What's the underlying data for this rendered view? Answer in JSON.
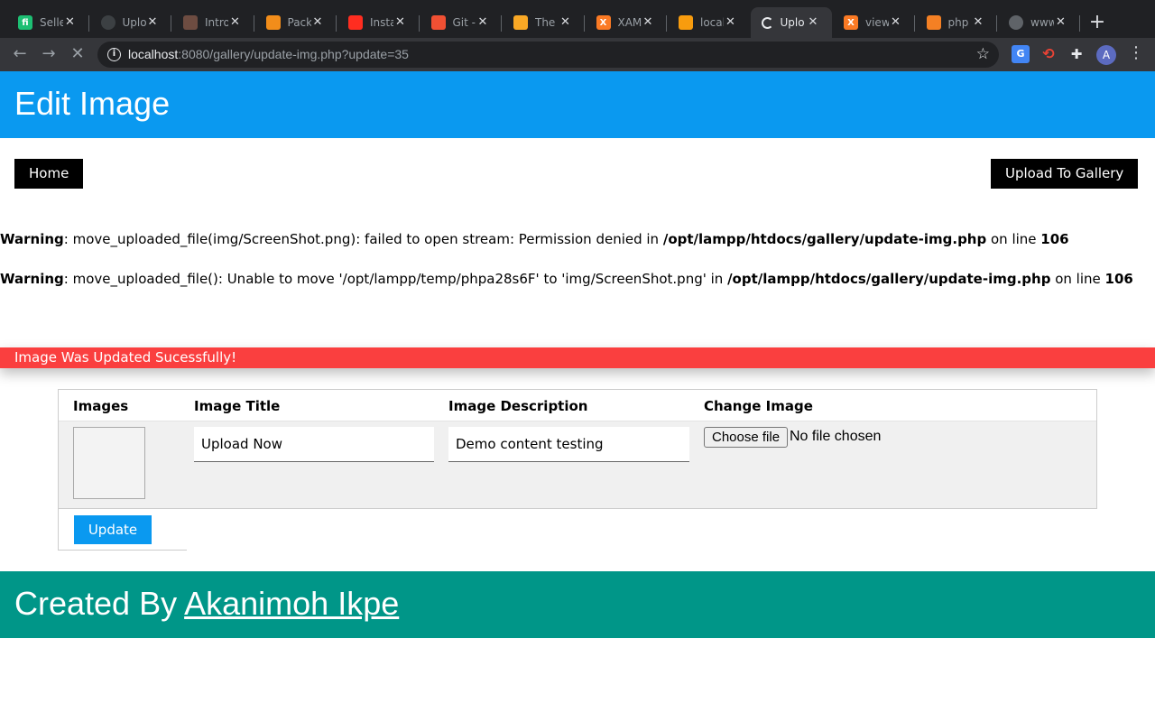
{
  "browser": {
    "tabs": [
      {
        "title": "Seller",
        "favicon": "fiverr-icon",
        "favicon_color": "#1dbf73",
        "favicon_char": "fi"
      },
      {
        "title": "Upload",
        "favicon": "globe-icon",
        "favicon_color": "#3c4043",
        "favicon_char": ""
      },
      {
        "title": "Intro",
        "favicon": "puppy-icon",
        "favicon_color": "#6d4c41",
        "favicon_char": ""
      },
      {
        "title": "Packagist",
        "favicon": "packagist-icon",
        "favicon_color": "#f28d1a",
        "favicon_char": ""
      },
      {
        "title": "Installation",
        "favicon": "laravel-icon",
        "favicon_color": "#ff2d20",
        "favicon_char": ""
      },
      {
        "title": "Git -",
        "favicon": "git-icon",
        "favicon_color": "#f05033",
        "favicon_char": ""
      },
      {
        "title": "The",
        "favicon": "beer-icon",
        "favicon_color": "#f9a825",
        "favicon_char": ""
      },
      {
        "title": "XAMPP",
        "favicon": "xampp-icon",
        "favicon_color": "#fb7a24",
        "favicon_char": "X"
      },
      {
        "title": "localhost",
        "favicon": "phpmyadmin-icon",
        "favicon_color": "#f89c0e",
        "favicon_char": ""
      },
      {
        "title": "Upload",
        "favicon": "loading-spinner-icon",
        "favicon_color": "#35363a",
        "favicon_char": ""
      },
      {
        "title": "view",
        "favicon": "xampp-icon",
        "favicon_color": "#fb7a24",
        "favicon_char": "X"
      },
      {
        "title": "php",
        "favicon": "stackoverflow-icon",
        "favicon_color": "#f48024",
        "favicon_char": ""
      },
      {
        "title": "www",
        "favicon": "globe-icon",
        "favicon_color": "#5f6368",
        "favicon_char": ""
      }
    ],
    "active_tab_index": 9,
    "url_host": "localhost",
    "url_rest": ":8080/gallery/update-img.php?update=35",
    "profile_initial": "A"
  },
  "header": {
    "title": "Edit Image"
  },
  "nav": {
    "home_label": "Home",
    "upload_label": "Upload To Gallery"
  },
  "warnings": [
    {
      "label": "Warning",
      "message": ": move_uploaded_file(img/ScreenShot.png): failed to open stream: Permission denied in ",
      "path": "/opt/lampp/htdocs/gallery/update-img.php",
      "on_line": " on line ",
      "line": "106"
    },
    {
      "label": "Warning",
      "message": ": move_uploaded_file(): Unable to move '/opt/lampp/temp/phpa28s6F' to 'img/ScreenShot.png' in ",
      "path": "/opt/lampp/htdocs/gallery/update-img.php",
      "on_line": " on line ",
      "line": "106"
    }
  ],
  "alert": {
    "text": "Image Was Updated Sucessfully!",
    "color": "#fa3f3f"
  },
  "table": {
    "headers": [
      "Images",
      "Image Title",
      "Image Description",
      "Change Image"
    ],
    "row": {
      "title_value": "Upload Now",
      "description_value": "Demo content testing",
      "file_button_label": "Choose file",
      "file_status": "No file chosen"
    }
  },
  "update_button_label": "Update",
  "footer": {
    "prefix": "Created By ",
    "author": "Akanimoh Ikpe"
  },
  "colors": {
    "header": "#0a99f0",
    "footer": "#009688",
    "button_dark": "#000000"
  }
}
